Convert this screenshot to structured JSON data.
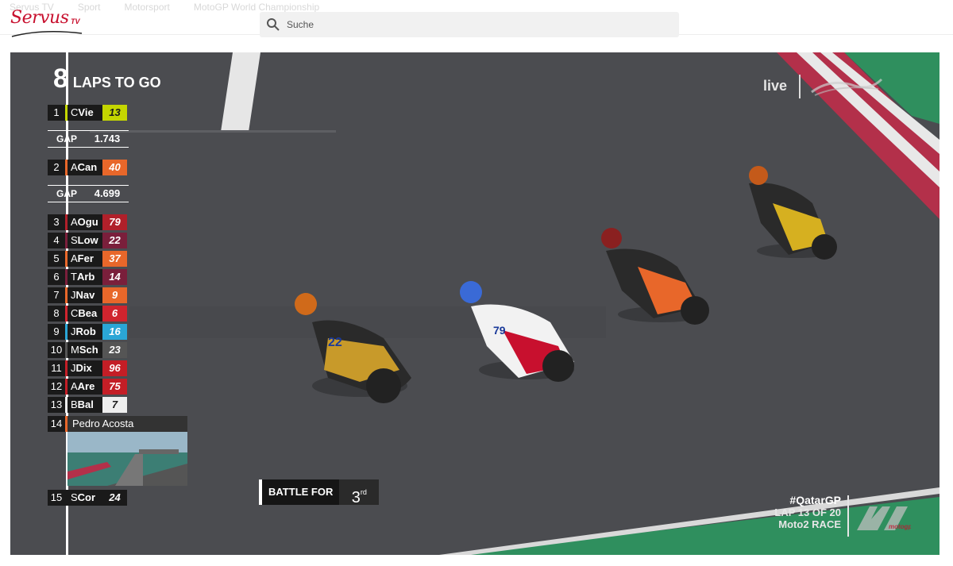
{
  "header": {
    "nav": [
      "Servus TV",
      "Sport",
      "Motorsport",
      "MotoGP World Championship"
    ],
    "logo_text": "Servus",
    "logo_tv": "TV",
    "search": {
      "placeholder": "Suche",
      "value": ""
    }
  },
  "broadcast": {
    "laps_to_go_number": "8",
    "laps_to_go_label": "LAPS TO GO",
    "live_label": "live",
    "standings": [
      {
        "pos": "1",
        "initial": "C",
        "name": "Vie",
        "number": "13",
        "color": "#c4d600",
        "numColor": "#1a1a1a"
      },
      {
        "pos": "2",
        "initial": "A",
        "name": "Can",
        "number": "40",
        "color": "#e8672a",
        "numColor": "#ffffff"
      },
      {
        "pos": "3",
        "initial": "A",
        "name": "Ogu",
        "number": "79",
        "color": "#b0202a",
        "numColor": "#ffffff"
      },
      {
        "pos": "4",
        "initial": "S",
        "name": "Low",
        "number": "22",
        "color": "#7a1f3b",
        "numColor": "#ffffff"
      },
      {
        "pos": "5",
        "initial": "A",
        "name": "Fer",
        "number": "37",
        "color": "#e8672a",
        "numColor": "#ffffff"
      },
      {
        "pos": "6",
        "initial": "T",
        "name": "Arb",
        "number": "14",
        "color": "#7a1f3b",
        "numColor": "#ffffff"
      },
      {
        "pos": "7",
        "initial": "J",
        "name": "Nav",
        "number": "9",
        "color": "#e8672a",
        "numColor": "#ffffff"
      },
      {
        "pos": "8",
        "initial": "C",
        "name": "Bea",
        "number": "6",
        "color": "#d0242e",
        "numColor": "#ffffff"
      },
      {
        "pos": "9",
        "initial": "J",
        "name": "Rob",
        "number": "16",
        "color": "#2aa6d6",
        "numColor": "#ffffff"
      },
      {
        "pos": "10",
        "initial": "M",
        "name": "Sch",
        "number": "23",
        "color": "#555555",
        "numColor": "#ffffff"
      },
      {
        "pos": "11",
        "initial": "J",
        "name": "Dix",
        "number": "96",
        "color": "#c41e26",
        "numColor": "#ffffff"
      },
      {
        "pos": "12",
        "initial": "A",
        "name": "Are",
        "number": "75",
        "color": "#c41e26",
        "numColor": "#ffffff"
      },
      {
        "pos": "13",
        "initial": "B",
        "name": "Bal",
        "number": "7",
        "color": "#eeeeee",
        "numColor": "#1a1a1a"
      },
      {
        "pos": "15",
        "initial": "S",
        "name": "Cor",
        "number": "24",
        "color": "#1a1a1a",
        "numColor": "#ffffff"
      }
    ],
    "gaps": [
      {
        "label": "GAP",
        "value": "1.743"
      },
      {
        "label": "GAP",
        "value": "4.699"
      }
    ],
    "onboard": {
      "pos": "14",
      "name": "Pedro Acosta",
      "color": "#e8672a"
    },
    "battle": {
      "label": "BATTLE FOR",
      "value": "3",
      "suffix": "rd"
    },
    "info": {
      "hashtag": "#QatarGP",
      "lap": "LAP 13 OF 20",
      "class": "Moto2 RACE"
    },
    "colors": {
      "track": "#4a4b4e",
      "grass": "#2f8f5e",
      "kerb_red": "#b3304a"
    }
  }
}
